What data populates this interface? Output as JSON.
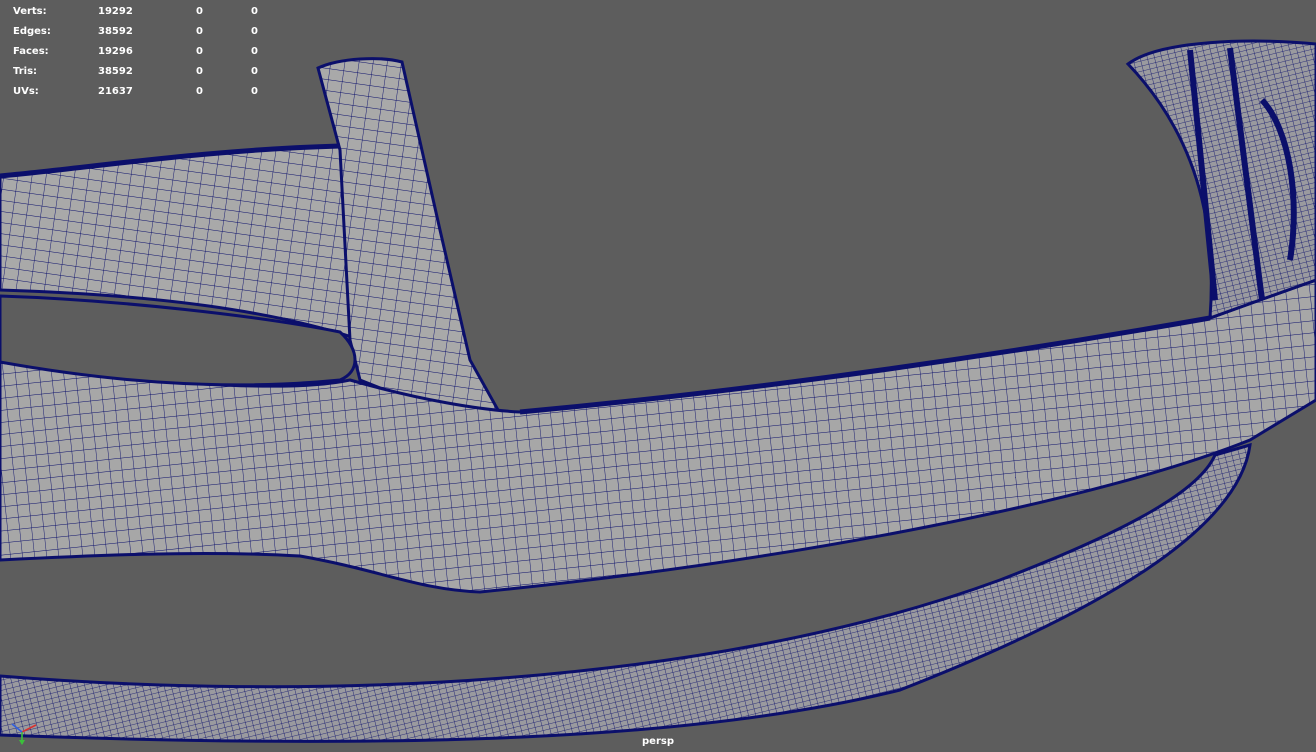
{
  "hud": {
    "rows": [
      {
        "label": "Verts:",
        "total": "19292",
        "selected": "0",
        "component": "0"
      },
      {
        "label": "Edges:",
        "total": "38592",
        "selected": "0",
        "component": "0"
      },
      {
        "label": "Faces:",
        "total": "19296",
        "selected": "0",
        "component": "0"
      },
      {
        "label": "Tris:",
        "total": "38592",
        "selected": "0",
        "component": "0"
      },
      {
        "label": "UVs:",
        "total": "21637",
        "selected": "0",
        "component": "0"
      }
    ]
  },
  "viewport": {
    "camera": "persp",
    "background_color": "#5d5d5d",
    "mesh_fill_color": "#a7a7a7",
    "wire_color": "#0b0f6b"
  },
  "gizmo": {
    "icon": "axis-gizmo-icon",
    "x_color": "#d8312e",
    "y_color": "#3bbf3b",
    "z_color": "#2f5fe0"
  }
}
